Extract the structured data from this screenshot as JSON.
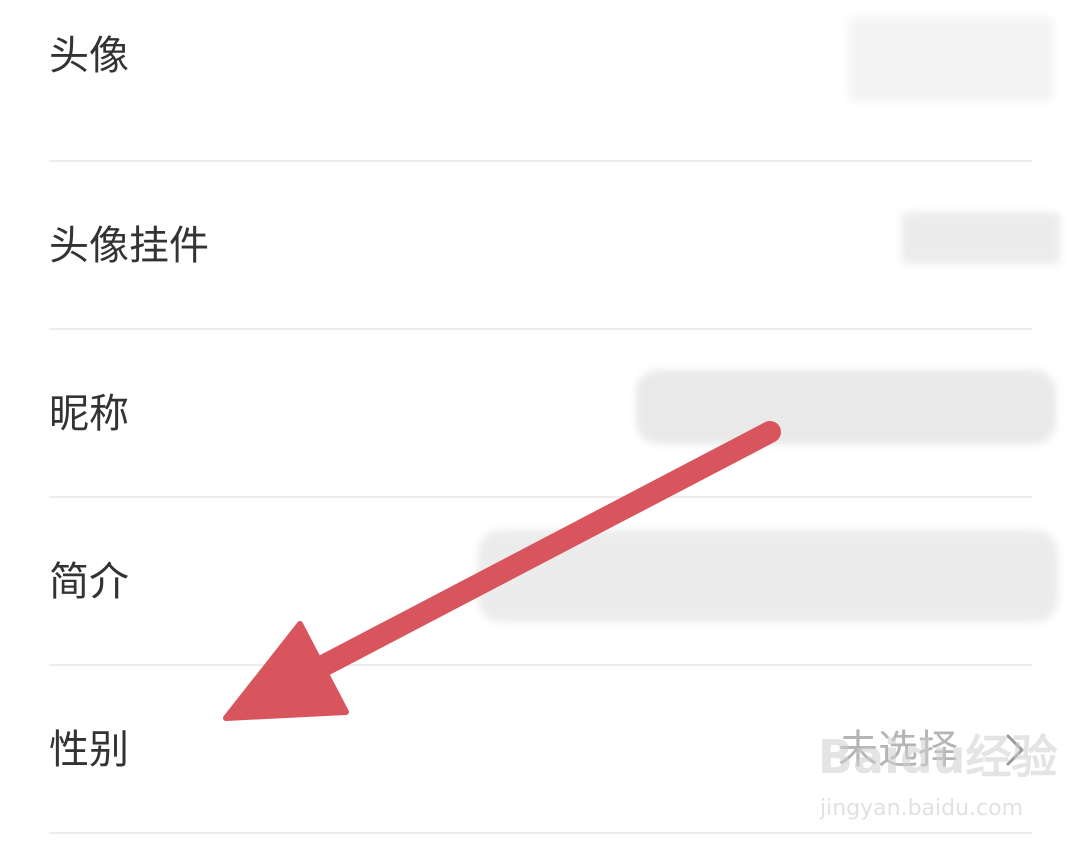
{
  "rows": [
    {
      "label": "头像"
    },
    {
      "label": "头像挂件"
    },
    {
      "label": "昵称"
    },
    {
      "label": "简介"
    },
    {
      "label": "性别",
      "value": "未选择"
    }
  ],
  "icons": {
    "chevron": "chevron-right-icon",
    "arrow": "annotation-arrow"
  },
  "colors": {
    "label": "#333333",
    "value": "#b5b5b5",
    "divider": "#ececec",
    "arrow": "#d9555e"
  },
  "watermark": {
    "logo": "Baidu经验",
    "url": "jingyan.baidu.com"
  }
}
